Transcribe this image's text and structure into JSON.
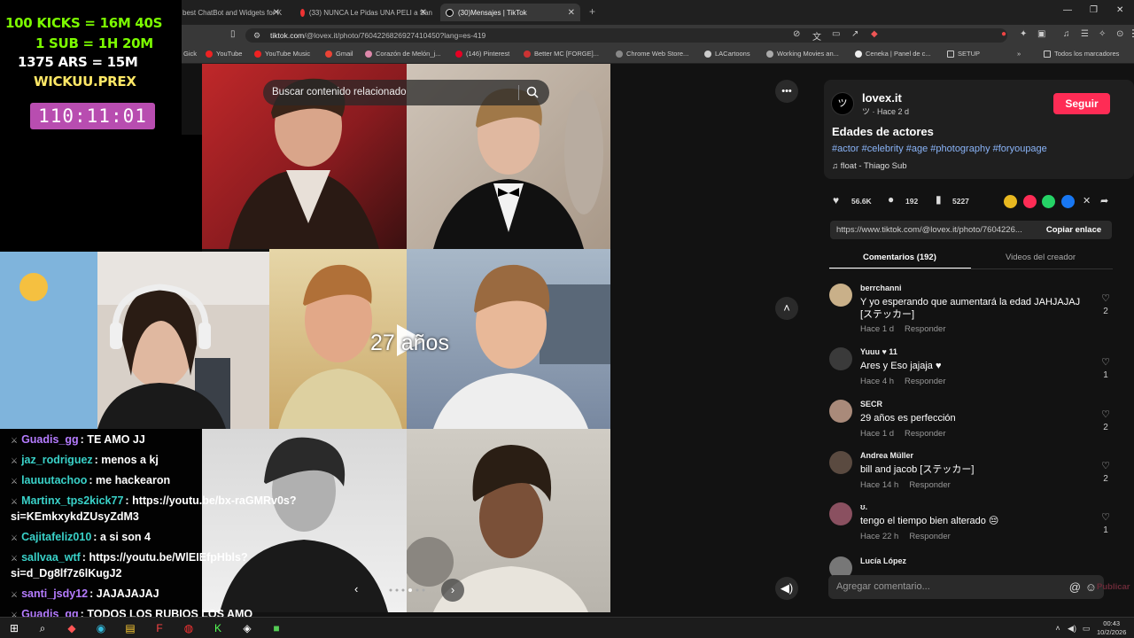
{
  "browser": {
    "tabs": [
      {
        "label": "best ChatBot and Widgets for K"
      },
      {
        "label": "(33) NUNCA Le Pidas UNA PELI a San"
      },
      {
        "label": "(30)Mensajes | TikTok"
      }
    ],
    "url_host": "tiktok.com",
    "url_path": "/@lovex.it/photo/7604226826927410450?lang=es-419",
    "bookmarks": [
      {
        "label": "Gick"
      },
      {
        "label": "YouTube"
      },
      {
        "label": "YouTube Music"
      },
      {
        "label": "Gmail"
      },
      {
        "label": "Corazón de Melón_j..."
      },
      {
        "label": "(146) Pinterest"
      },
      {
        "label": "Better MC [FORGE]..."
      },
      {
        "label": "Chrome Web Store..."
      },
      {
        "label": "LACartoons"
      },
      {
        "label": "Working Movies an..."
      },
      {
        "label": "Ceneka | Panel de c..."
      },
      {
        "label": "SETUP"
      },
      {
        "label": "Todos los marcadores"
      }
    ]
  },
  "stream_overlay": {
    "lines": [
      "100 KICKS = 16M 40S",
      "1 SUB = 1H 20M",
      "1375 ARS = 15M",
      "WICKUU.PREX"
    ],
    "timer": "110:11:01"
  },
  "chat": [
    {
      "user": "Guadis_gg",
      "color": "#b57cff",
      "message": "TE AMO JJ"
    },
    {
      "user": "jaz_rodriguez",
      "color": "#39d1c8",
      "message": "menos a kj"
    },
    {
      "user": "lauuutachoo",
      "color": "#39d1c8",
      "message": "me hackearon"
    },
    {
      "user": "Martinx_tps2kick77",
      "color": "#39d1c8",
      "message": "https://youtu.be/bx-raGMRv0s?"
    },
    {
      "user": "",
      "color": "#fff",
      "message": "si=KEmkxykdZUsyZdM3"
    },
    {
      "user": "Cajitafeliz010",
      "color": "#39d1c8",
      "message": "a si son 4"
    },
    {
      "user": "sallvaa_wtf",
      "color": "#39d1c8",
      "message": "https://youtu.be/WlEIEfpHbls?"
    },
    {
      "user": "",
      "color": "#fff",
      "message": "si=d_Dg8lf7z6lKugJ2"
    },
    {
      "user": "santi_jsdy12",
      "color": "#b57cff",
      "message": "JAJAJAJAJ"
    },
    {
      "user": "Guadis_gg",
      "color": "#b57cff",
      "message": "TODOS LOS RUBIOS LOS AMO"
    }
  ],
  "viewer": {
    "search_placeholder": "Buscar contenido relacionado",
    "overlay_text": "27 años"
  },
  "post": {
    "username": "lovex.it",
    "posted": "ツ · Hace 2 d",
    "follow_label": "Seguir",
    "title": "Edades de actores",
    "hashtags": "#actor #celebrity #age #photography #foryoupage",
    "music": "float - Thiago Sub",
    "likes": "56.6K",
    "comments_count": "192",
    "saves": "5227",
    "link": "https://www.tiktok.com/@lovex.it/photo/7604226...",
    "copy_label": "Copiar enlace",
    "tab_comments": "Comentarios (192)",
    "tab_videos": "Videos del creador",
    "reply_label": "Responder",
    "comment_placeholder": "Agregar comentario...",
    "publish_label": "Publicar"
  },
  "comments": [
    {
      "user": "berrchanni",
      "text": "Y yo esperando que aumentará la edad JAHJAJAJ [ステッカー]",
      "time": "Hace 1 d",
      "likes": "2",
      "avatar": "#c9b089"
    },
    {
      "user": "Yuuu ♥ 11",
      "text": "Ares y Eso jajaja ♥",
      "time": "Hace 4 h",
      "likes": "1",
      "avatar": "#3a3a3a"
    },
    {
      "user": "SECR",
      "text": "29 años es perfección",
      "time": "Hace 1 d",
      "likes": "2",
      "avatar": "#a98a7a"
    },
    {
      "user": "Andrea Müller",
      "text": "bill and jacob [ステッカー]",
      "time": "Hace 14 h",
      "likes": "2",
      "avatar": "#5a4a40"
    },
    {
      "user": "ʊ.",
      "text": "tengo el tiempo bien alterado 😔",
      "time": "Hace 22 h",
      "likes": "1",
      "avatar": "#8a5060"
    },
    {
      "user": "Lucía López",
      "text": "",
      "time": "",
      "likes": "",
      "avatar": "#777"
    }
  ],
  "taskbar": {
    "time": "00:43",
    "date": "10/2/2026"
  },
  "colors": {
    "accent": "#fe2c55",
    "panel": "#121212",
    "card": "#1f1f1f"
  }
}
